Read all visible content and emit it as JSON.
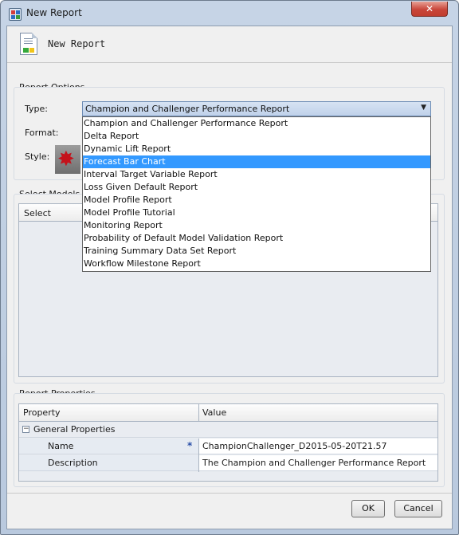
{
  "window": {
    "title": "New Report",
    "close_label": "✕"
  },
  "header": {
    "title": "New Report"
  },
  "report_options": {
    "section_label": "Report Options",
    "type_label": "Type:",
    "type_value": "Champion and Challenger Performance Report",
    "format_label": "Format:",
    "style_label": "Style:",
    "type_options": [
      "Champion and Challenger Performance Report",
      "Delta Report",
      "Dynamic Lift Report",
      "Forecast Bar Chart",
      "Interval Target Variable Report",
      "Loss Given Default Report",
      "Model Profile Report",
      "Model Profile Tutorial",
      "Monitoring Report",
      "Probability of Default Model Validation Report",
      "Training Summary Data Set Report",
      "Workflow Milestone Report"
    ],
    "highlighted_option": "Forecast Bar Chart"
  },
  "select_models": {
    "section_label": "Select Models",
    "column_select": "Select"
  },
  "report_properties": {
    "section_label": "Report Properties",
    "col_property": "Property",
    "col_value": "Value",
    "group_label": "General Properties",
    "rows": [
      {
        "property": "Name",
        "required": "*",
        "value": "ChampionChallenger_D2015-05-20T21.57"
      },
      {
        "property": "Description",
        "required": "",
        "value": "The Champion and Challenger Performance Report"
      }
    ]
  },
  "buttons": {
    "ok": "OK",
    "cancel": "Cancel"
  }
}
